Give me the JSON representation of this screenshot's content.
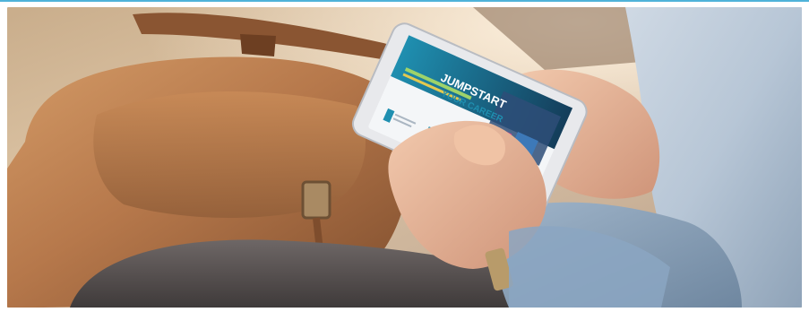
{
  "photo": {
    "subject": "person-holding-smartphone"
  },
  "phone_screen": {
    "headline": "JUMPSTART",
    "subheadline": "YOUR CAREER"
  },
  "colors": {
    "accent": "#4fb3d9",
    "screen_teal": "#1f8fb0",
    "screen_dark": "#143d5a",
    "bag_brown": "#b6784b"
  }
}
